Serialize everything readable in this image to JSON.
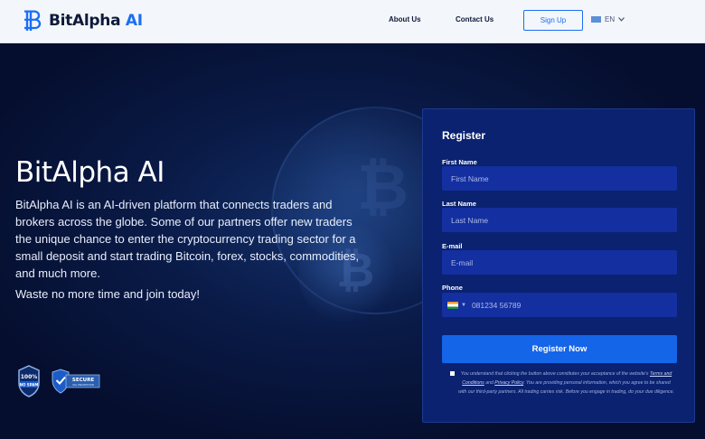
{
  "header": {
    "logo_text": "BitAlpha",
    "logo_accent": "AI",
    "nav": {
      "about": "About Us",
      "contact": "Contact Us"
    },
    "signup_label": "Sign Up",
    "language": "EN"
  },
  "hero": {
    "title": "BitAlpha AI",
    "description": "BitAlpha AI is an AI-driven platform that connects traders and brokers across the globe. Some of our partners offer new traders the unique chance to enter the cryptocurrency trading sector for a small deposit and start trading Bitcoin, forex, stocks, commodities, and much more.",
    "cta_text": "Waste no more time and join today!",
    "badges": {
      "no_spam_top": "100%",
      "no_spam_bottom": "NO SPAM",
      "secure_top": "SECURE",
      "secure_bottom": "SSL ENCRYPTION"
    }
  },
  "form": {
    "title": "Register",
    "first_name_label": "First Name",
    "first_name_placeholder": "First Name",
    "last_name_label": "Last Name",
    "last_name_placeholder": "Last Name",
    "email_label": "E-mail",
    "email_placeholder": "E-mail",
    "phone_label": "Phone",
    "phone_placeholder": "081234 56789",
    "submit_label": "Register Now",
    "consent_prefix": "You understand that clicking the button above constitutes your acceptance of the website's ",
    "terms_link": "Terms and Conditions",
    "consent_and": " and ",
    "privacy_link": "Privacy Policy",
    "consent_suffix": ". You are providing personal information, which you agree to be shared with our third-party partners. All trading carries risk. Before you engage in trading, do your due diligence."
  },
  "colors": {
    "accent": "#1b6ef3",
    "form_bg": "#0a2270",
    "field_bg": "#142fa0",
    "button": "#1565e8",
    "hero_bg": "#050e2e"
  }
}
